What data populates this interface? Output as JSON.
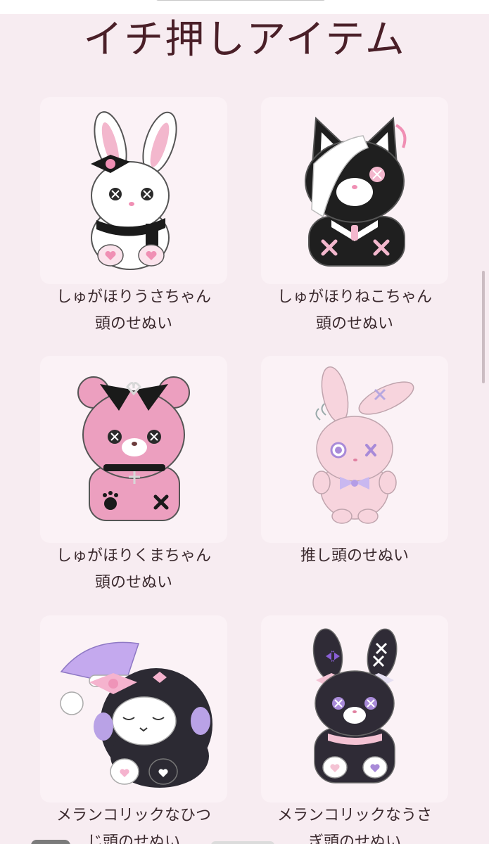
{
  "section": {
    "title": "イチ押しアイテム"
  },
  "items": [
    {
      "name_line1": "しゅがほりうさちゃん",
      "name_line2": "頭のせぬい",
      "icon": "white-bunny-plush-icon"
    },
    {
      "name_line1": "しゅがほりねこちゃん",
      "name_line2": "頭のせぬい",
      "icon": "black-cat-plush-icon"
    },
    {
      "name_line1": "しゅがほりくまちゃん",
      "name_line2": "頭のせぬい",
      "icon": "pink-bear-plush-icon"
    },
    {
      "name_line1": "推し頭のせぬい",
      "name_line2": "",
      "icon": "pink-bunny-plush-icon"
    },
    {
      "name_line1": "メランコリックなひつ",
      "name_line2": "じ頭のせぬい",
      "icon": "sheep-plush-icon"
    },
    {
      "name_line1": "メランコリックなうさ",
      "name_line2": "ぎ頭のせぬい",
      "icon": "black-bunny-plush-icon"
    }
  ],
  "colors": {
    "background": "#f7ecf1",
    "card": "#fbf2f6",
    "title": "#4a1f28",
    "accent_pink": "#f1a9c3",
    "accent_purple": "#a88ad8"
  }
}
